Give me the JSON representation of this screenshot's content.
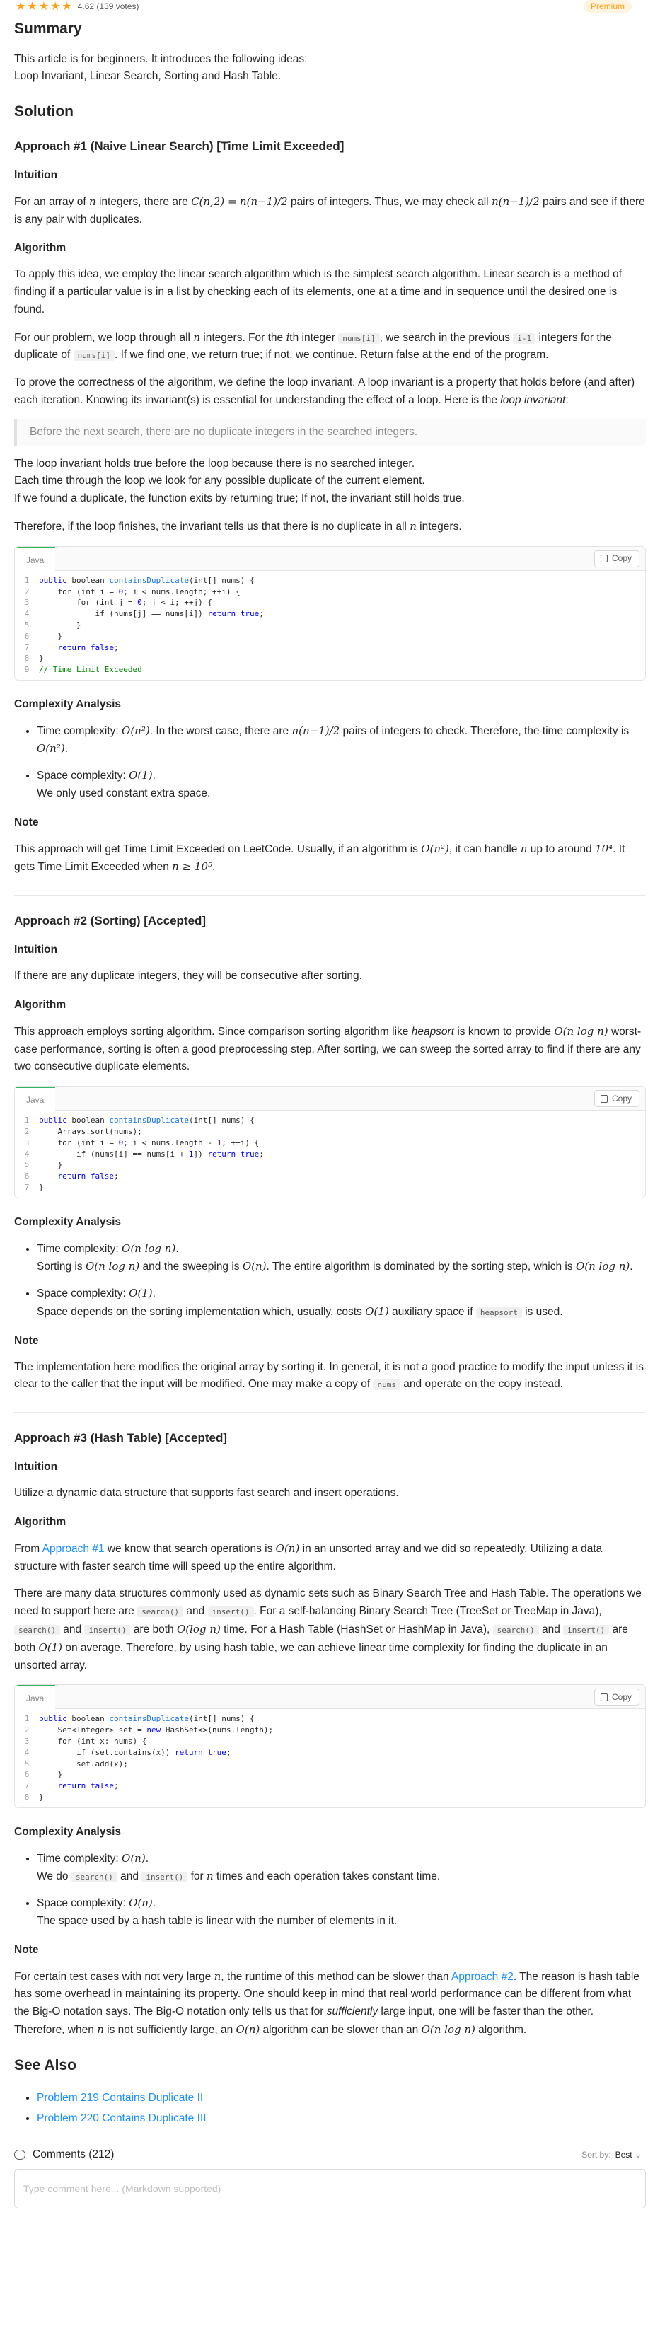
{
  "header": {
    "stars": [
      "★",
      "★",
      "★",
      "★",
      "★"
    ],
    "rating": "4.62 (139 votes)",
    "premium": "Premium"
  },
  "summary": {
    "title": "Summary",
    "p1": "This article is for beginners. It introduces the following ideas:",
    "p2": "Loop Invariant, Linear Search, Sorting and Hash Table."
  },
  "solution_title": "Solution",
  "a1": {
    "title": "Approach #1 (Naive Linear Search) [Time Limit Exceeded]",
    "intuition_h": "Intuition",
    "intuition_pre": "For an array of",
    "intuition_n": "n",
    "intuition_mid": "integers, there are",
    "intuition_c": "C(n,2) =",
    "frac": "n(n−1)/2",
    "intuition_mid2": "pairs of integers. Thus, we may check all",
    "intuition_end": "pairs and see if there is any pair with duplicates.",
    "algorithm_h": "Algorithm",
    "alg1": "To apply this idea, we employ the linear search algorithm which is the simplest search algorithm. Linear search is a method of finding if a particular value is in a list by checking each of its elements, one at a time and in sequence until the desired one is found.",
    "alg2_a": "For our problem, we loop through all",
    "alg2_b": "integers. For the",
    "alg2_i": "i",
    "alg2_c": "th integer",
    "alg2_code1": "nums[i]",
    "alg2_d": ", we search in the previous",
    "alg2_code2": "i-1",
    "alg2_e": "integers for the duplicate of",
    "alg2_code3": "nums[i]",
    "alg2_f": ". If we find one, we return true; if not, we continue. Return false at the end of the program.",
    "alg3": "To prove the correctness of the algorithm, we define the loop invariant. A loop invariant is a property that holds before (and after) each iteration. Knowing its invariant(s) is essential for understanding the effect of a loop. Here is the",
    "alg3_em": "loop invariant",
    "alg3_end": ":",
    "quote": "Before the next search, there are no duplicate integers in the searched integers.",
    "inv1": "The loop invariant holds true before the loop because there is no searched integer.",
    "inv2": "Each time through the loop we look for any possible duplicate of the current element.",
    "inv3": "If we found a duplicate, the function exits by returning true; If not, the invariant still holds true.",
    "therefore": "Therefore, if the loop finishes, the invariant tells us that there is no duplicate in all",
    "therefore_end": "integers.",
    "code_lang": "Java",
    "copy": "Copy",
    "complexity_h": "Complexity Analysis",
    "time_label": "Time complexity:",
    "time_o": "O(n²)",
    "time_rest": ". In the worst case, there are",
    "time_rest2": "pairs of integers to check. Therefore, the time complexity is",
    "time_o2": "O(n²)",
    "space_label": "Space complexity:",
    "space_o": "O(1)",
    "space_rest": "We only used constant extra space.",
    "note_h": "Note",
    "note1": "This approach will get Time Limit Exceeded on LeetCode. Usually, if an algorithm is",
    "note_o": "O(n²)",
    "note2": ", it can handle",
    "note3": "up to around",
    "note_104": "10⁴",
    "note4": ". It gets Time Limit Exceeded when",
    "note_ge": "n ≥ 10⁵",
    "note5": "."
  },
  "a2": {
    "title": "Approach #2 (Sorting) [Accepted]",
    "intuition_h": "Intuition",
    "intuition": "If there are any duplicate integers, they will be consecutive after sorting.",
    "algorithm_h": "Algorithm",
    "alg1": "This approach employs sorting algorithm. Since comparison sorting algorithm like",
    "alg_em": "heapsort",
    "alg2": "is known to provide",
    "alg_o": "O(n log n)",
    "alg3": "worst-case performance, sorting is often a good preprocessing step. After sorting, we can sweep the sorted array to find if there are any two consecutive duplicate elements.",
    "code_lang": "Java",
    "copy": "Copy",
    "complexity_h": "Complexity Analysis",
    "time_label": "Time complexity:",
    "time_o": "O(n log n)",
    "time_a": "Sorting is",
    "time_b": "and the sweeping is",
    "time_on": "O(n)",
    "time_c": ". The entire algorithm is dominated by the sorting step, which is",
    "space_label": "Space complexity:",
    "space_o": "O(1)",
    "space_a": "Space depends on the sorting implementation which, usually, costs",
    "space_b": "auxiliary space if",
    "space_code": "heapsort",
    "space_c": "is used.",
    "note_h": "Note",
    "note1": "The implementation here modifies the original array by sorting it. In general, it is not a good practice to modify the input unless it is clear to the caller that the input will be modified. One may make a copy of",
    "note_code": "nums",
    "note2": "and operate on the copy instead."
  },
  "a3": {
    "title": "Approach #3 (Hash Table) [Accepted]",
    "intuition_h": "Intuition",
    "intuition": "Utilize a dynamic data structure that supports fast search and insert operations.",
    "algorithm_h": "Algorithm",
    "alg1_a": "From",
    "alg1_link": "Approach #1",
    "alg1_b": "we know that search operations is",
    "alg1_o": "O(n)",
    "alg1_c": "in an unsorted array and we did so repeatedly. Utilizing a data structure with faster search time will speed up the entire algorithm.",
    "alg2_a": "There are many data structures commonly used as dynamic sets such as Binary Search Tree and Hash Table. The operations we need to support here are",
    "code_search": "search()",
    "and": "and",
    "code_insert": "insert()",
    "alg2_b": ". For a self-balancing Binary Search Tree (TreeSet or TreeMap in Java),",
    "alg2_c": "are both",
    "alg2_olog": "O(log n)",
    "alg2_d": "time. For a Hash Table (HashSet or HashMap in Java),",
    "alg2_o1": "O(1)",
    "alg2_e": "on average. Therefore, by using hash table, we can achieve linear time complexity for finding the duplicate in an unsorted array.",
    "code_lang": "Java",
    "copy": "Copy",
    "complexity_h": "Complexity Analysis",
    "time_label": "Time complexity:",
    "time_o": "O(n)",
    "time_a": "We do",
    "time_b": "for",
    "time_c": "times and each operation takes constant time.",
    "space_label": "Space complexity:",
    "space_o": "O(n)",
    "space_a": "The space used by a hash table is linear with the number of elements in it.",
    "note_h": "Note",
    "note_a": "For certain test cases with not very large",
    "note_b": ", the runtime of this method can be slower than",
    "note_link": "Approach #2",
    "note_c": ". The reason is hash table has some overhead in maintaining its property. One should keep in mind that real world performance can be different from what the Big-O notation says. The Big-O notation only tells us that for",
    "note_em": "sufficiently",
    "note_d": "large input, one will be faster than the other. Therefore, when",
    "note_e": "is not sufficiently large, an",
    "note_on": "O(n)",
    "note_f": "algorithm can be slower than an",
    "note_onlog": "O(n log n)",
    "note_g": "algorithm."
  },
  "see_also": {
    "title": "See Also",
    "links": [
      "Problem 219 Contains Duplicate II",
      "Problem 220 Contains Duplicate III"
    ]
  },
  "comments": {
    "label": "Comments (212)",
    "sort_label": "Sort by:",
    "sort_value": "Best",
    "placeholder": "Type comment here... (Markdown supported)"
  },
  "code1": [
    "public boolean containsDuplicate(int[] nums) {",
    "    for (int i = 0; i < nums.length; ++i) {",
    "        for (int j = 0; j < i; ++j) {",
    "            if (nums[j] == nums[i]) return true;",
    "        }",
    "    }",
    "    return false;",
    "}",
    "// Time Limit Exceeded"
  ],
  "code2": [
    "public boolean containsDuplicate(int[] nums) {",
    "    Arrays.sort(nums);",
    "    for (int i = 0; i < nums.length - 1; ++i) {",
    "        if (nums[i] == nums[i + 1]) return true;",
    "    }",
    "    return false;",
    "}"
  ],
  "code3": [
    "public boolean containsDuplicate(int[] nums) {",
    "    Set<Integer> set = new HashSet<>(nums.length);",
    "    for (int x: nums) {",
    "        if (set.contains(x)) return true;",
    "        set.add(x);",
    "    }",
    "    return false;",
    "}"
  ]
}
